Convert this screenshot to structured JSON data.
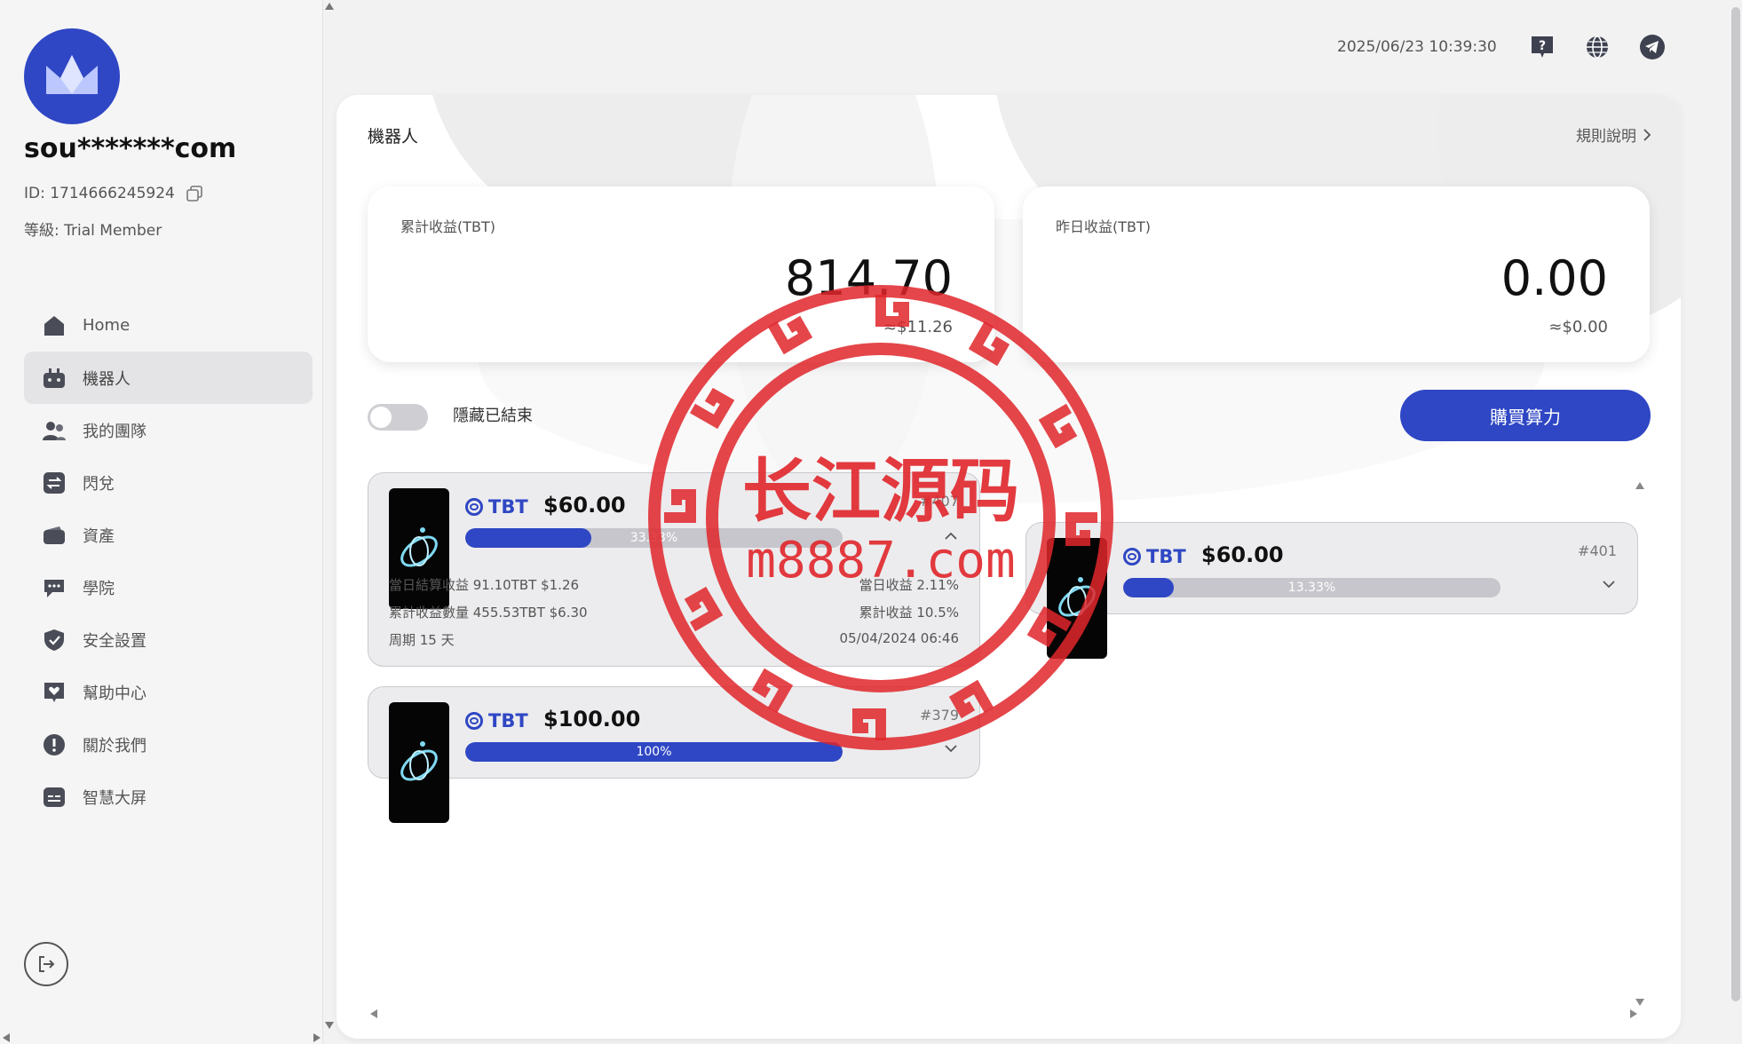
{
  "sidebar": {
    "username": "sou*******com",
    "id_text": "ID: 1714666245924",
    "level_text": "等級: Trial Member",
    "items": [
      {
        "label": "Home",
        "icon": "home-icon"
      },
      {
        "label": "機器人",
        "icon": "robot-icon"
      },
      {
        "label": "我的團隊",
        "icon": "team-icon"
      },
      {
        "label": "閃兌",
        "icon": "swap-icon"
      },
      {
        "label": "資產",
        "icon": "wallet-icon"
      },
      {
        "label": "學院",
        "icon": "chat-icon"
      },
      {
        "label": "安全設置",
        "icon": "shield-icon"
      },
      {
        "label": "幫助中心",
        "icon": "help-heart-icon"
      },
      {
        "label": "關於我們",
        "icon": "info-icon"
      },
      {
        "label": "智慧大屏",
        "icon": "screen-icon"
      }
    ],
    "active_index": 1
  },
  "topbar": {
    "datetime": "2025/06/23 10:39:30"
  },
  "main": {
    "title": "機器人",
    "rules_label": "規則說明",
    "total_earnings": {
      "label": "累計收益(TBT)",
      "value": "814.70",
      "usd": "≈$11.26"
    },
    "yesterday_earnings": {
      "label": "昨日收益(TBT)",
      "value": "0.00",
      "usd": "≈$0.00"
    },
    "hide_finished_label": "隱藏已結束",
    "hide_finished_on": false,
    "buy_button": "購買算力"
  },
  "robots": [
    {
      "coin": "TBT",
      "price": "$60.00",
      "order": "#407",
      "progress": 0.3333,
      "progress_label": "33.33%",
      "expanded": true,
      "daily_income": "當日結算收益 91.10TBT $1.26",
      "daily_rate": "當日收益 2.11%",
      "total_income": "累計收益數量 455.53TBT $6.30",
      "total_rate": "累計收益 10.5%",
      "period": "周期 15 天",
      "date": "05/04/2024 06:46"
    },
    {
      "coin": "TBT",
      "price": "$60.00",
      "order": "#401",
      "progress": 0.1333,
      "progress_label": "13.33%",
      "expanded": false
    },
    {
      "coin": "TBT",
      "price": "$100.00",
      "order": "#379",
      "progress": 1.0,
      "progress_label": "100%",
      "expanded": false
    }
  ],
  "watermark": {
    "text_cn": "长江源码",
    "text_url": "m8887.com",
    "color": "#e0262b"
  },
  "colors": {
    "accent": "#2f47c4",
    "sidebar_bg": "#f5f5f6",
    "card_bg": "#ececee"
  }
}
